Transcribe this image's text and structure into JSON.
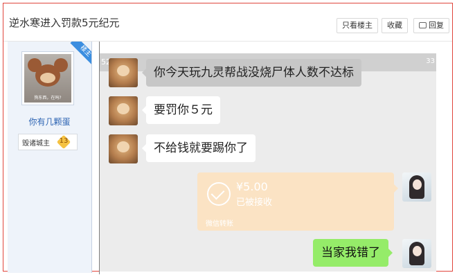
{
  "header": {
    "title": "逆水寒进入罚款5元纪元",
    "only_op_label": "只看楼主",
    "favorite_label": "收藏",
    "reply_label": "回复"
  },
  "author": {
    "op_ribbon": "楼主",
    "avatar_caption": "狗东西，在吗?",
    "username": "你有几颗蛋",
    "badge_title": "毁诸城主",
    "badge_level": "13"
  },
  "chat": {
    "status_left": "52",
    "status_right": "33",
    "messages": [
      {
        "text": "你今天玩九灵帮战没烧尸体人数不达标"
      },
      {
        "text": "要罚你５元"
      },
      {
        "text": "不给钱就要踢你了"
      },
      {
        "text": "当家我错了"
      }
    ],
    "transfer": {
      "amount": "¥5.00",
      "status": "已被接收",
      "footer": "微信转账"
    }
  }
}
